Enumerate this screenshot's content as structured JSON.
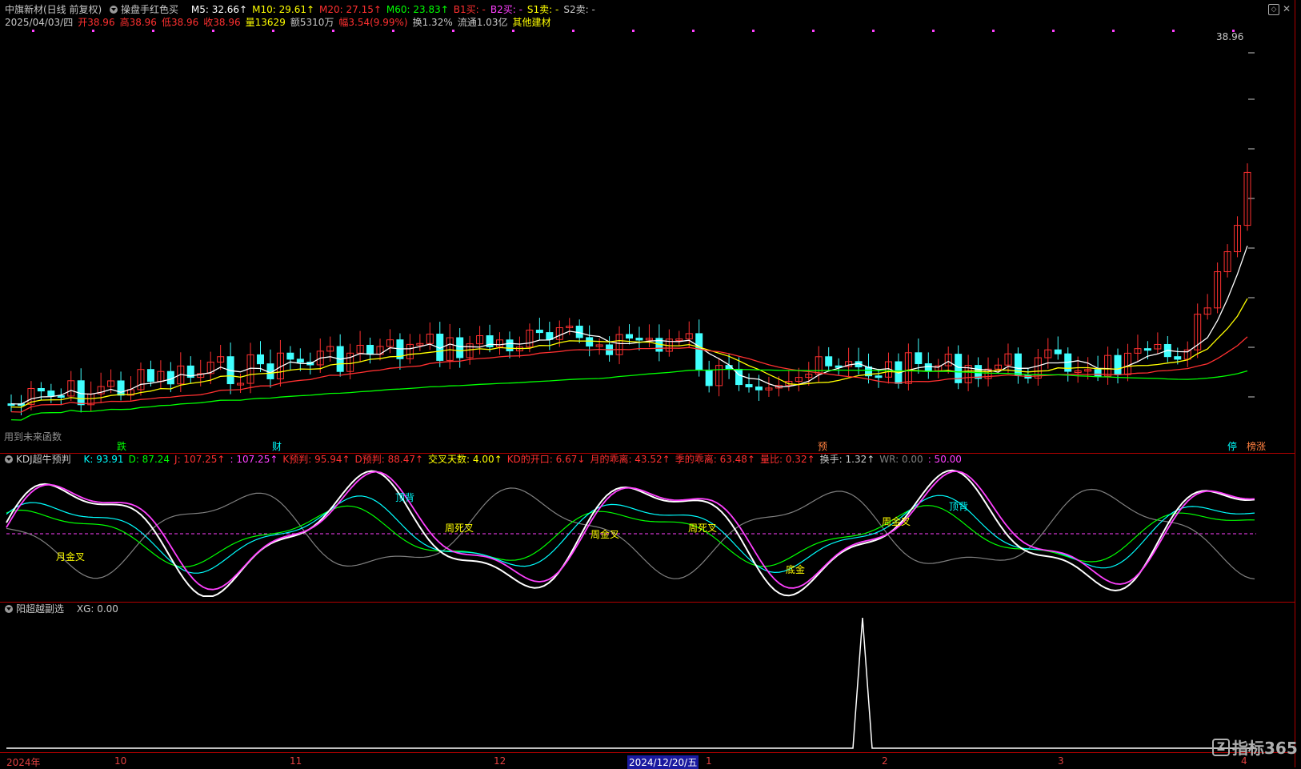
{
  "main": {
    "stock_title": "中旗新材(日线 前复权)",
    "indicator_name": "操盘手红色买",
    "ma": [
      {
        "label": "M5: 32.66↑",
        "color": "#ffffff"
      },
      {
        "label": "M10: 29.61↑",
        "color": "#ffff00"
      },
      {
        "label": "M20: 27.15↑",
        "color": "#ff3030"
      },
      {
        "label": "M60: 23.83↑",
        "color": "#00ff00"
      },
      {
        "label": "B1买: -",
        "color": "#ff3030"
      },
      {
        "label": "B2买: -",
        "color": "#ff40ff"
      },
      {
        "label": "S1卖: -",
        "color": "#ffff00"
      },
      {
        "label": "S2卖: -",
        "color": "#c8c8c8"
      }
    ],
    "info": [
      {
        "label": "2025/04/03/四",
        "color": "#c8c8c8"
      },
      {
        "label": "开38.96",
        "color": "#ff3030"
      },
      {
        "label": "高38.96",
        "color": "#ff3030"
      },
      {
        "label": "低38.96",
        "color": "#ff3030"
      },
      {
        "label": "收38.96",
        "color": "#ff3030"
      },
      {
        "label": "量13629",
        "color": "#ffff00"
      },
      {
        "label": "额5310万",
        "color": "#c8c8c8"
      },
      {
        "label": "幅3.54(9.99%)",
        "color": "#ff3030"
      },
      {
        "label": "换1.32%",
        "color": "#c8c8c8"
      },
      {
        "label": "流通1.03亿",
        "color": "#c8c8c8"
      },
      {
        "label": "其他建材",
        "color": "#ffff00"
      }
    ],
    "price_label": "38.96",
    "bottom_note": "用到未来函数",
    "markers": [
      {
        "text": "跌",
        "color": "#00ff00"
      },
      {
        "text": "财",
        "color": "#00ffff"
      },
      {
        "text": "预",
        "color": "#ff8040"
      },
      {
        "text": "停",
        "color": "#00ffff"
      },
      {
        "text": "榜涨",
        "color": "#ff8040"
      }
    ]
  },
  "kdj": {
    "name": "KDJ超牛预判",
    "values": [
      {
        "label": "K: 93.91",
        "color": "#00ffff"
      },
      {
        "label": "D: 87.24",
        "color": "#00ff00"
      },
      {
        "label": "J: 107.25↑",
        "color": "#ff3030"
      },
      {
        "label": ": 107.25↑",
        "color": "#ff40ff"
      },
      {
        "label": "K预判: 95.94↑",
        "color": "#ff3030"
      },
      {
        "label": "D预判: 88.47↑",
        "color": "#ff3030"
      },
      {
        "label": "交叉天数: 4.00↑",
        "color": "#ffff00"
      },
      {
        "label": "KD的开口: 6.67↓",
        "color": "#ff3030"
      },
      {
        "label": "月的乖离: 43.52↑",
        "color": "#ff3030"
      },
      {
        "label": "季的乖离: 63.48↑",
        "color": "#ff3030"
      },
      {
        "label": "量比: 0.32↑",
        "color": "#ff3030"
      },
      {
        "label": "换手: 1.32↑",
        "color": "#c8c8c8"
      },
      {
        "label": "WR: 0.00",
        "color": "#808080"
      },
      {
        "label": ": 50.00",
        "color": "#ff40ff"
      }
    ],
    "annotations": [
      {
        "text": "月金叉",
        "color": "#ffff00"
      },
      {
        "text": "顶背",
        "color": "#00ffff"
      },
      {
        "text": "周死叉",
        "color": "#ffff00"
      },
      {
        "text": "周金叉",
        "color": "#ffff00"
      },
      {
        "text": "周死叉",
        "color": "#ffff00"
      },
      {
        "text": "底金",
        "color": "#ffff00"
      },
      {
        "text": "周金叉",
        "color": "#ffff00"
      },
      {
        "text": "顶背",
        "color": "#00ffff"
      }
    ]
  },
  "xg": {
    "name": "阳超越副选",
    "value": "XG: 0.00"
  },
  "time_axis": {
    "labels": [
      "2024年",
      "10",
      "11",
      "12",
      "2024/12/20/五",
      "1",
      "2",
      "3",
      "4"
    ]
  },
  "watermark": "指标365"
}
